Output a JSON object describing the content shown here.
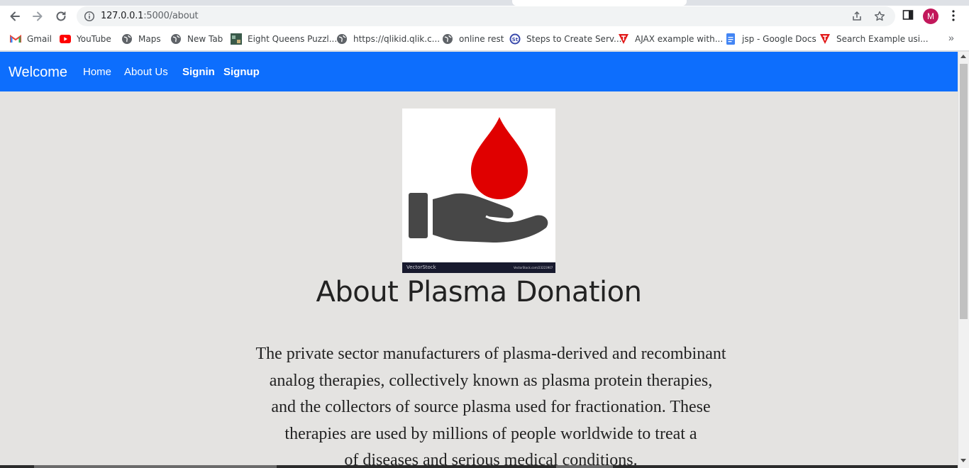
{
  "browser": {
    "url_host": "127.0.0.1",
    "url_path": ":5000/about",
    "avatar_letter": "M",
    "icons": {
      "back": "back-arrow-icon",
      "forward": "forward-arrow-icon",
      "reload": "reload-icon",
      "info": "info-icon",
      "share": "share-icon",
      "star": "bookmark-star-icon",
      "sidepanel": "side-panel-icon",
      "menu": "kebab-menu-icon"
    },
    "bookmarks": [
      {
        "label": "Gmail",
        "icon": "gmail-icon"
      },
      {
        "label": "YouTube",
        "icon": "youtube-icon"
      },
      {
        "label": "Maps",
        "icon": "globe-icon"
      },
      {
        "label": "New Tab",
        "icon": "globe-icon"
      },
      {
        "label": "Eight Queens Puzzl...",
        "icon": "image-thumb-icon"
      },
      {
        "label": "https://qlikid.qlik.c...",
        "icon": "globe-icon"
      },
      {
        "label": "online rest",
        "icon": "globe-icon"
      },
      {
        "label": "Steps to Create Serv...",
        "icon": "st-logo-icon"
      },
      {
        "label": "AJAX example with...",
        "icon": "red-t-icon"
      },
      {
        "label": "jsp - Google Docs",
        "icon": "google-docs-icon"
      },
      {
        "label": "Search Example usi...",
        "icon": "red-t-icon"
      }
    ],
    "bookmarks_overflow": "»"
  },
  "navbar": {
    "brand": "Welcome",
    "links": [
      {
        "label": "Home",
        "bold": false
      },
      {
        "label": "About Us",
        "bold": false
      },
      {
        "label": "Signin",
        "bold": true
      },
      {
        "label": "Signup",
        "bold": true
      }
    ],
    "color": "#0d6efd"
  },
  "hero": {
    "image_icon": "hand-holding-blood-drop-icon",
    "watermark_left": "VectorStock",
    "watermark_right": "VectorStock.com/23223907",
    "drop_color": "#e00000",
    "hand_color": "#474747"
  },
  "content": {
    "heading": "About Plasma Donation",
    "lines": [
      "The private sector manufacturers of plasma-derived and recombinant",
      "analog therapies, collectively known as plasma protein therapies,",
      "and the collectors of source plasma used for fractionation. These",
      "therapies are used by millions of people worldwide to treat a",
      "of diseases and serious medical conditions."
    ]
  }
}
